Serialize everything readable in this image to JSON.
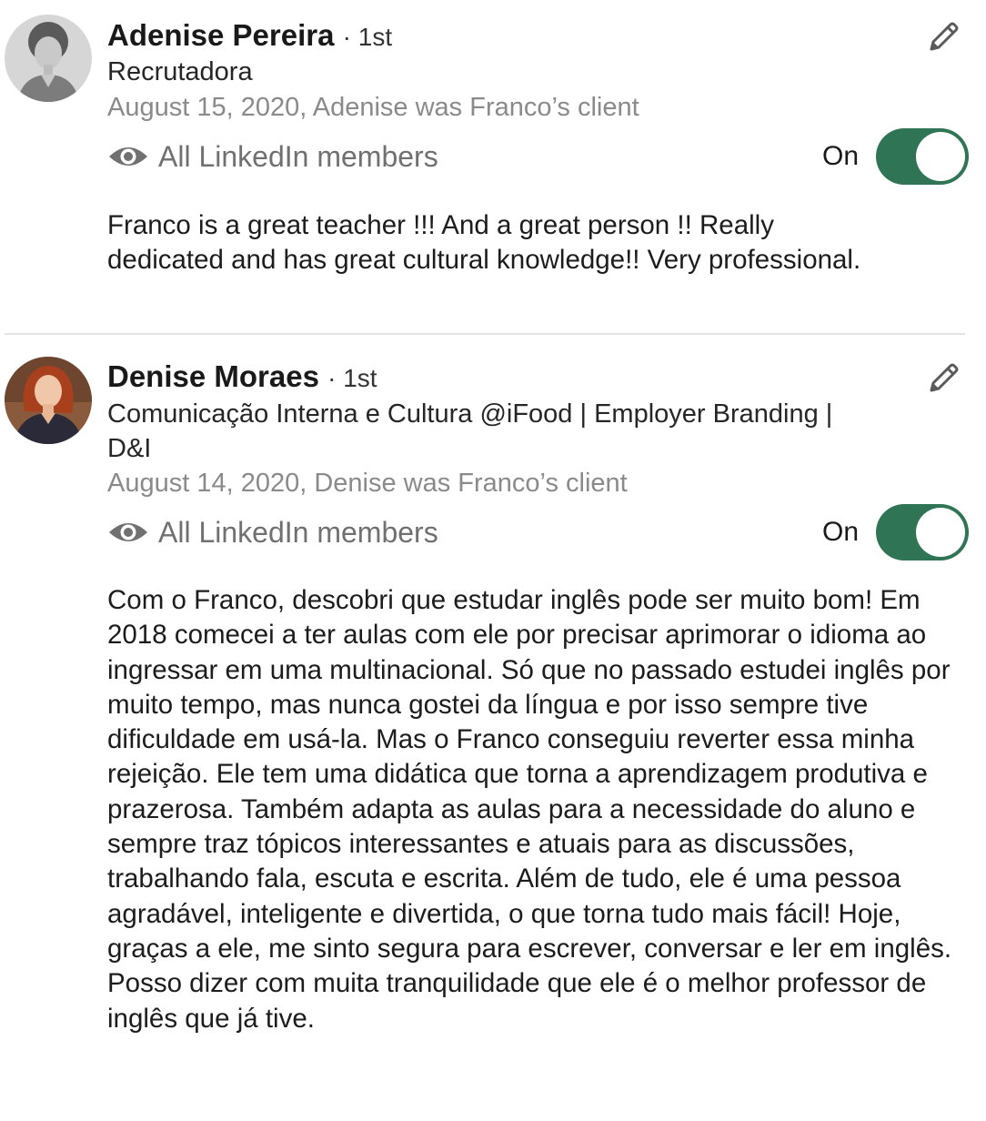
{
  "recommendations": [
    {
      "name": "Adenise Pereira",
      "degree": "· 1st",
      "headline": "Recrutadora",
      "meta": "August 15, 2020, Adenise was Franco’s client",
      "visibility": "All LinkedIn members",
      "toggle_label": "On",
      "toggle_on": true,
      "text": "Franco is a great teacher !!! And a great person !! Really dedicated and has great cultural knowledge!! Very professional."
    },
    {
      "name": "Denise Moraes",
      "degree": "· 1st",
      "headline": "Comunicação Interna e Cultura @iFood | Employer Branding | D&I",
      "meta": "August 14, 2020, Denise was Franco’s client",
      "visibility": "All LinkedIn members",
      "toggle_label": "On",
      "toggle_on": true,
      "text": "Com o Franco, descobri que estudar inglês pode ser muito bom! Em 2018 comecei a ter aulas com ele por precisar aprimorar o idioma ao ingressar em uma multinacional. Só que no passado estudei inglês por muito tempo, mas nunca gostei da língua e por isso sempre tive dificuldade em usá-la. Mas o Franco conseguiu reverter essa minha rejeição. Ele tem uma didática que torna a aprendizagem produtiva e prazerosa. Também adapta as aulas para a necessidade do aluno e sempre traz tópicos interessantes e atuais para as discussões, trabalhando fala, escuta e escrita. Além de tudo, ele é uma pessoa agradável, inteligente e divertida, o que torna tudo mais fácil! Hoje, graças a ele, me sinto segura para escrever, conversar e ler em inglês. Posso dizer com muita tranquilidade que ele é o melhor professor de inglês que já tive."
    }
  ],
  "icons": {
    "avatar_1": "avatar-photo",
    "avatar_2": "avatar-photo",
    "edit": "pencil-icon",
    "visibility": "eye-icon"
  },
  "colors": {
    "toggle_on": "#2f7555",
    "meta_text": "#8a8a8a",
    "visibility_text": "#707070",
    "divider": "#e4e4e4"
  }
}
